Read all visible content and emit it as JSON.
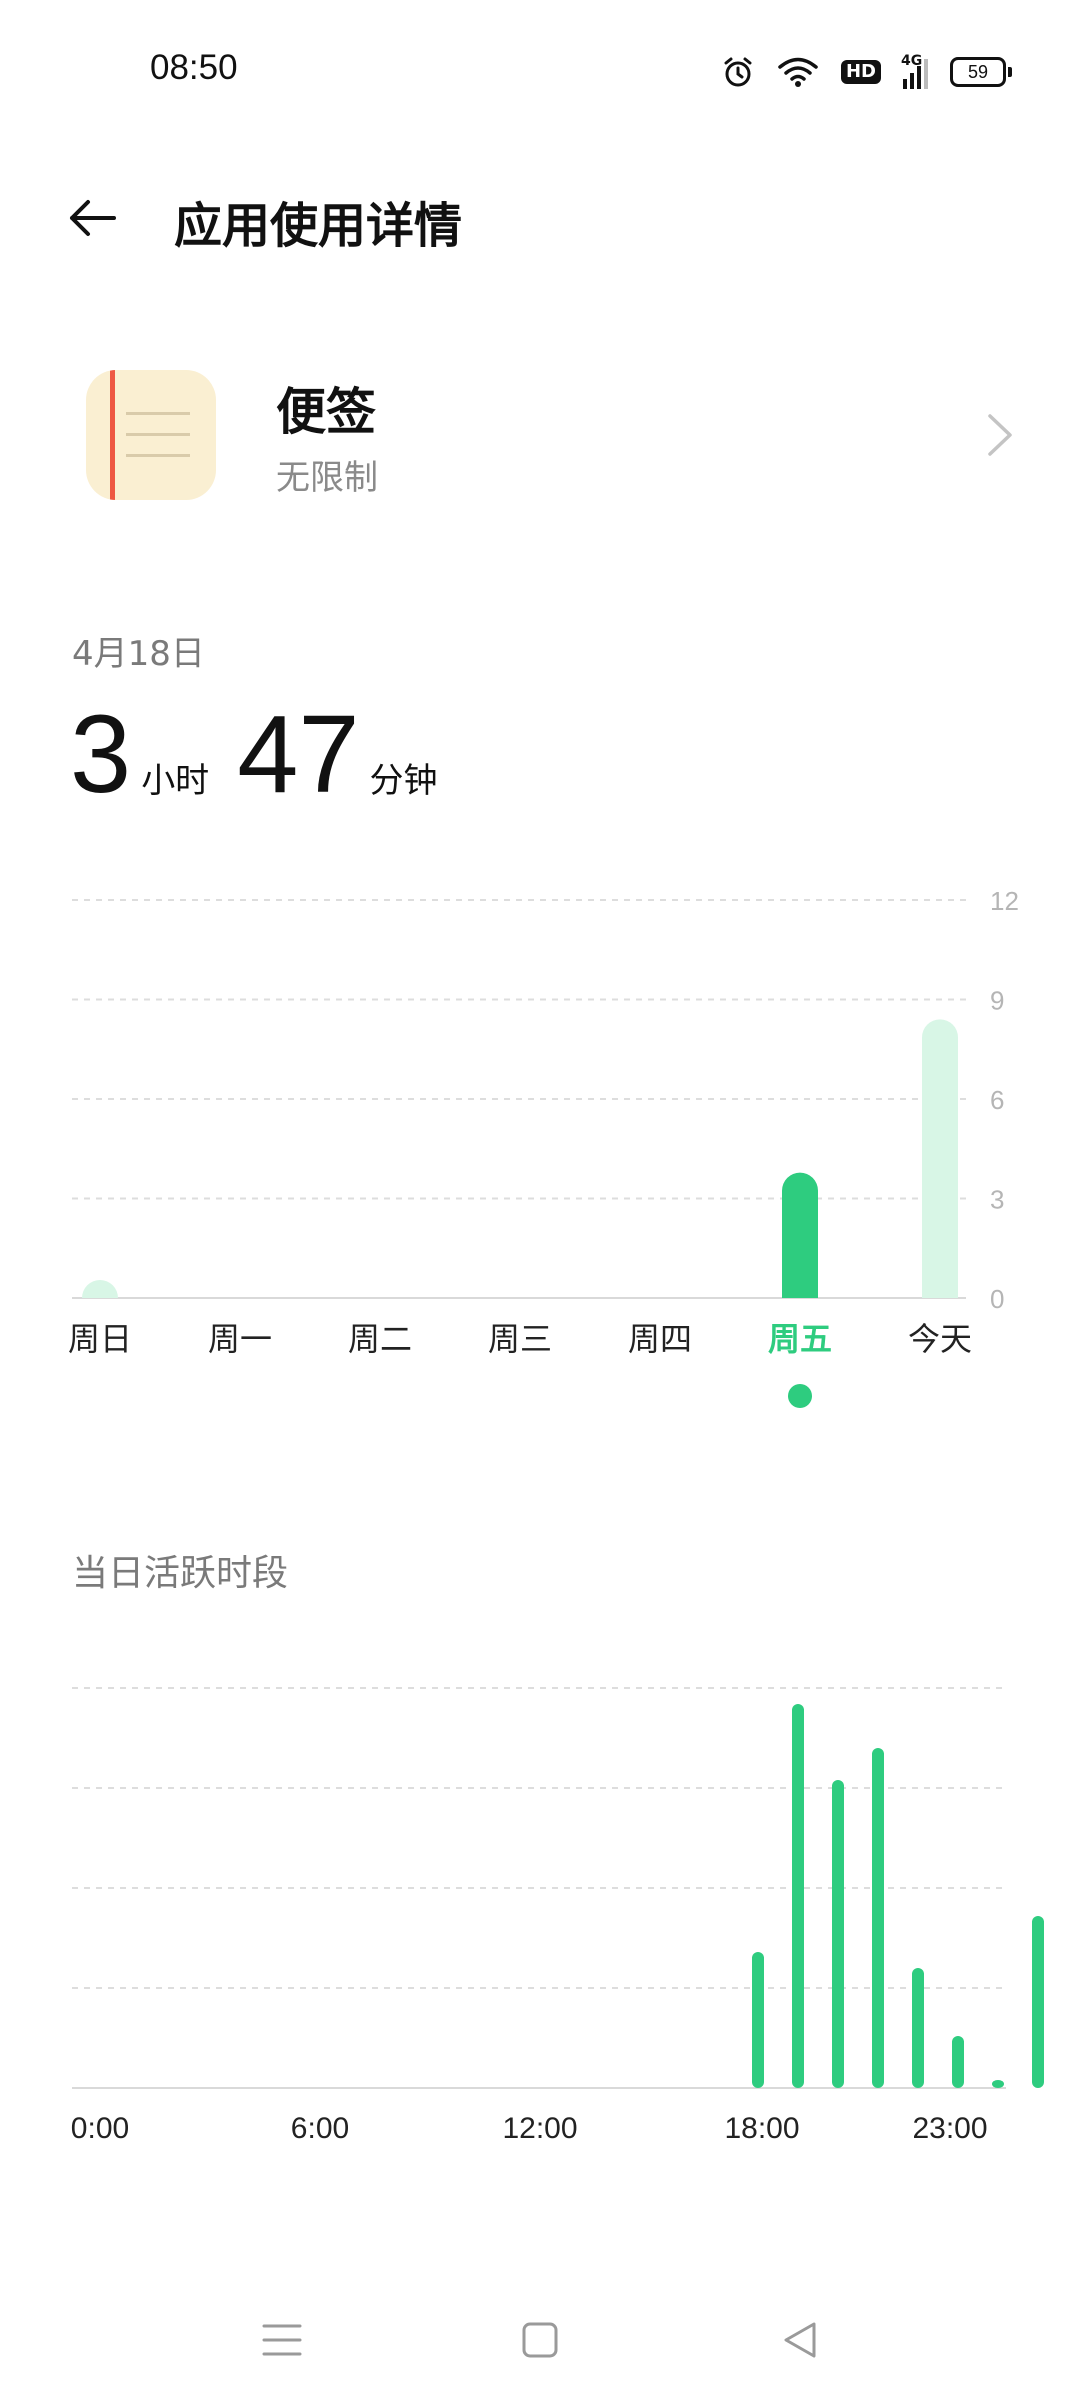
{
  "status_bar": {
    "time": "08:50",
    "battery": "59",
    "hd_badge": "HD",
    "network": "4G",
    "icons": [
      "alarm-icon",
      "wifi-icon",
      "hd-icon",
      "signal-icon",
      "battery-icon"
    ]
  },
  "header": {
    "title": "应用使用详情",
    "back_icon": "arrow-left-icon"
  },
  "app": {
    "name": "便签",
    "status": "无限制",
    "icon": "notes-app-icon",
    "chevron_icon": "chevron-right-icon"
  },
  "usage": {
    "date": "4月18日",
    "hours": "3",
    "hours_unit": "小时",
    "minutes": "47",
    "minutes_unit": "分钟"
  },
  "colors": {
    "accent": "#2ecc7f",
    "accent_light": "#d8f6e6",
    "grid": "#dddddd",
    "axis_text": "#b5b5b5"
  },
  "chart_data": [
    {
      "type": "bar",
      "name": "weekly",
      "categories": [
        "周日",
        "周一",
        "周二",
        "周三",
        "周四",
        "周五",
        "今天"
      ],
      "values": [
        0.3,
        0,
        0,
        0,
        0,
        3.78,
        8.4
      ],
      "selected_index": 5,
      "yticks": [
        "12",
        "9",
        "6",
        "3",
        "0"
      ],
      "ylim": [
        0,
        12
      ],
      "grid": true
    },
    {
      "type": "bar",
      "name": "hourly",
      "title": "当日活跃时段",
      "xtick_labels": [
        "0:00",
        "6:00",
        "12:00",
        "18:00",
        "23:00"
      ],
      "x": [
        17,
        18,
        19,
        20,
        21,
        22,
        23,
        24
      ],
      "values": [
        34,
        96,
        77,
        85,
        30,
        13,
        2,
        43
      ],
      "ylim": [
        0,
        100
      ],
      "grid": true
    }
  ],
  "nav": {
    "icons": [
      "menu-icon",
      "home-icon",
      "back-triangle-icon"
    ]
  }
}
